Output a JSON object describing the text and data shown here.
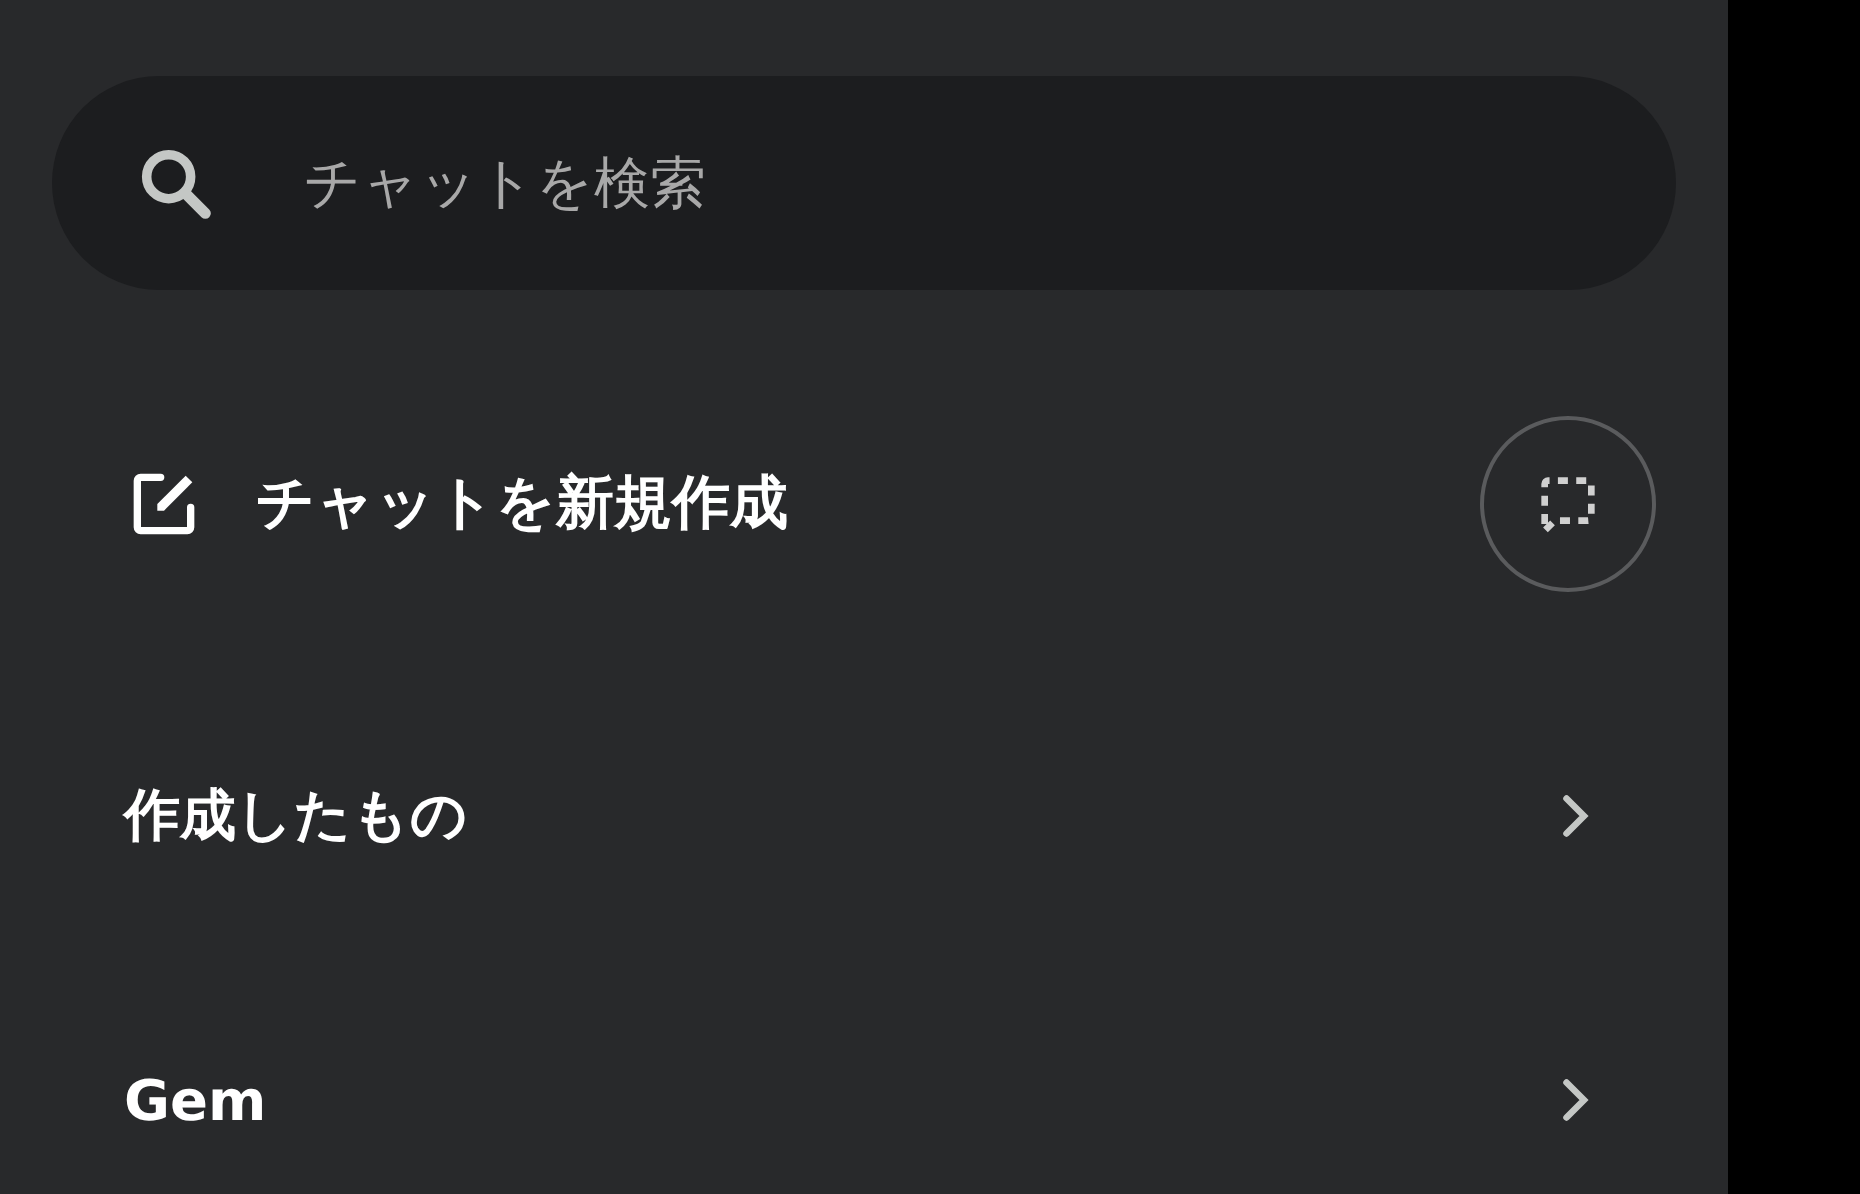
{
  "search": {
    "placeholder": "チャットを検索"
  },
  "new_chat": {
    "label": "チャットを新規作成"
  },
  "nav_items": [
    {
      "label": "作成したもの"
    },
    {
      "label": "Gem"
    }
  ]
}
